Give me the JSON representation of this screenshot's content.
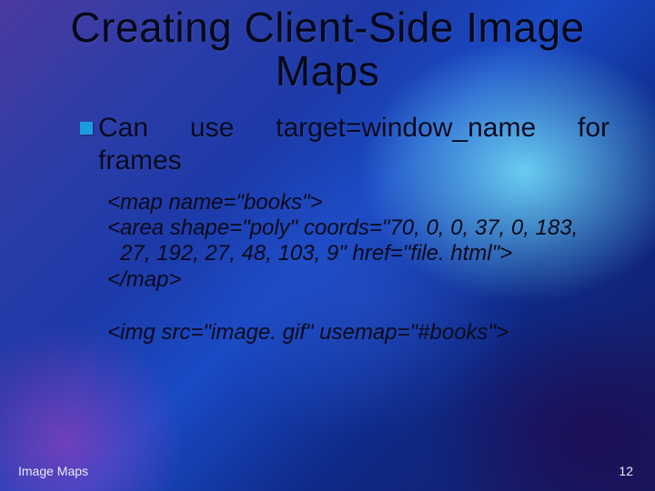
{
  "title": "Creating Client-Side Image Maps",
  "bullet": {
    "text_parts": [
      "Can",
      "use",
      "target=window_name",
      "for",
      "frames"
    ]
  },
  "code1": [
    "<map name=\"books\">",
    "<area shape=\"poly\" coords=\"70, 0, 0, 37, 0, 183, 27, 192, 27, 48, 103, 9\" href=\"file. html\">",
    "</map>"
  ],
  "code2": [
    "<img src=\"image. gif\" usemap=\"#books\">"
  ],
  "footer": {
    "left": "Image Maps",
    "right": "12"
  }
}
